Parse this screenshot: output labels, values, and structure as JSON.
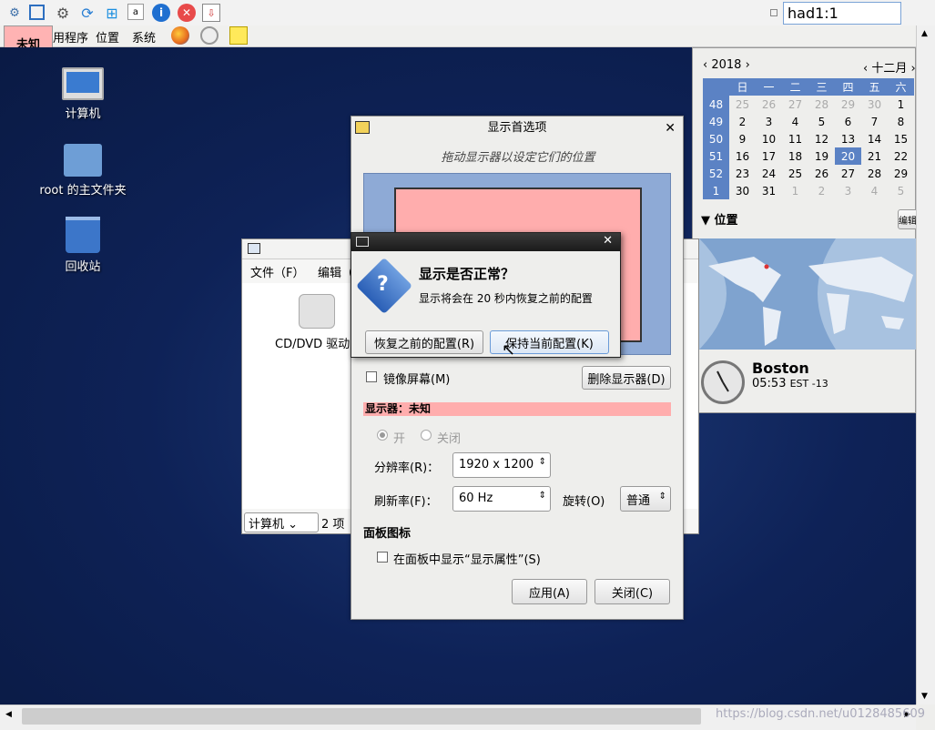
{
  "toolbar": {
    "vm_name": "had1:1",
    "icons": [
      "network-icon",
      "fullscreen-icon",
      "settings-icon",
      "refresh-icon",
      "windows-icon",
      "disk-icon",
      "info-icon",
      "close-icon",
      "download-icon"
    ]
  },
  "panel": {
    "tag": "未知",
    "menus": [
      "用程序",
      "位置",
      "系统"
    ]
  },
  "desktop": {
    "icons": [
      {
        "label": "计算机"
      },
      {
        "label": "root 的主文件夹"
      },
      {
        "label": "回收站"
      }
    ]
  },
  "calendar": {
    "year": "2018",
    "month": "十二月",
    "weekdays": [
      "日",
      "一",
      "二",
      "三",
      "四",
      "五",
      "六"
    ],
    "weeks": [
      {
        "wk": "48",
        "days": [
          "25",
          "26",
          "27",
          "28",
          "29",
          "30",
          "1"
        ]
      },
      {
        "wk": "49",
        "days": [
          "2",
          "3",
          "4",
          "5",
          "6",
          "7",
          "8"
        ]
      },
      {
        "wk": "50",
        "days": [
          "9",
          "10",
          "11",
          "12",
          "13",
          "14",
          "15"
        ]
      },
      {
        "wk": "51",
        "days": [
          "16",
          "17",
          "18",
          "19",
          "20",
          "21",
          "22"
        ]
      },
      {
        "wk": "52",
        "days": [
          "23",
          "24",
          "25",
          "26",
          "27",
          "28",
          "29"
        ]
      },
      {
        "wk": "1",
        "days": [
          "30",
          "31",
          "1",
          "2",
          "3",
          "4",
          "5"
        ]
      }
    ],
    "location_label": "位置",
    "edit_label": "编辑",
    "city": "Boston",
    "time": "05:53",
    "tz": "EST -13"
  },
  "filewin": {
    "menus": [
      "文件（F）",
      "编辑（"
    ],
    "item": "CD/DVD 驱动",
    "location": "计算机",
    "count": "2 项"
  },
  "dispwin": {
    "title": "显示首选项",
    "hint": "拖动显示器以设定它们的位置",
    "mirror": "镜像屏幕(M)",
    "remove": "删除显示器(D)",
    "monitor": "显示器：未知",
    "on": "开",
    "off": "关闭",
    "res_label": "分辨率(R)：",
    "res_value": "1920 x 1200",
    "rate_label": "刷新率(F)：",
    "rate_value": "60 Hz",
    "rot_label": "旋转(O)",
    "rot_value": "普通",
    "panel_icon": "面板图标",
    "show_in_panel": "在面板中显示“显示属性”(S)",
    "apply": "应用(A)",
    "close": "关闭(C)"
  },
  "dialog": {
    "title": "显示是否正常？",
    "message": "显示将会在 20 秒内恢复之前的配置",
    "revert": "恢复之前的配置(R)",
    "keep": "保持当前配置(K)"
  },
  "watermark": "https://blog.csdn.net/u0128485609"
}
